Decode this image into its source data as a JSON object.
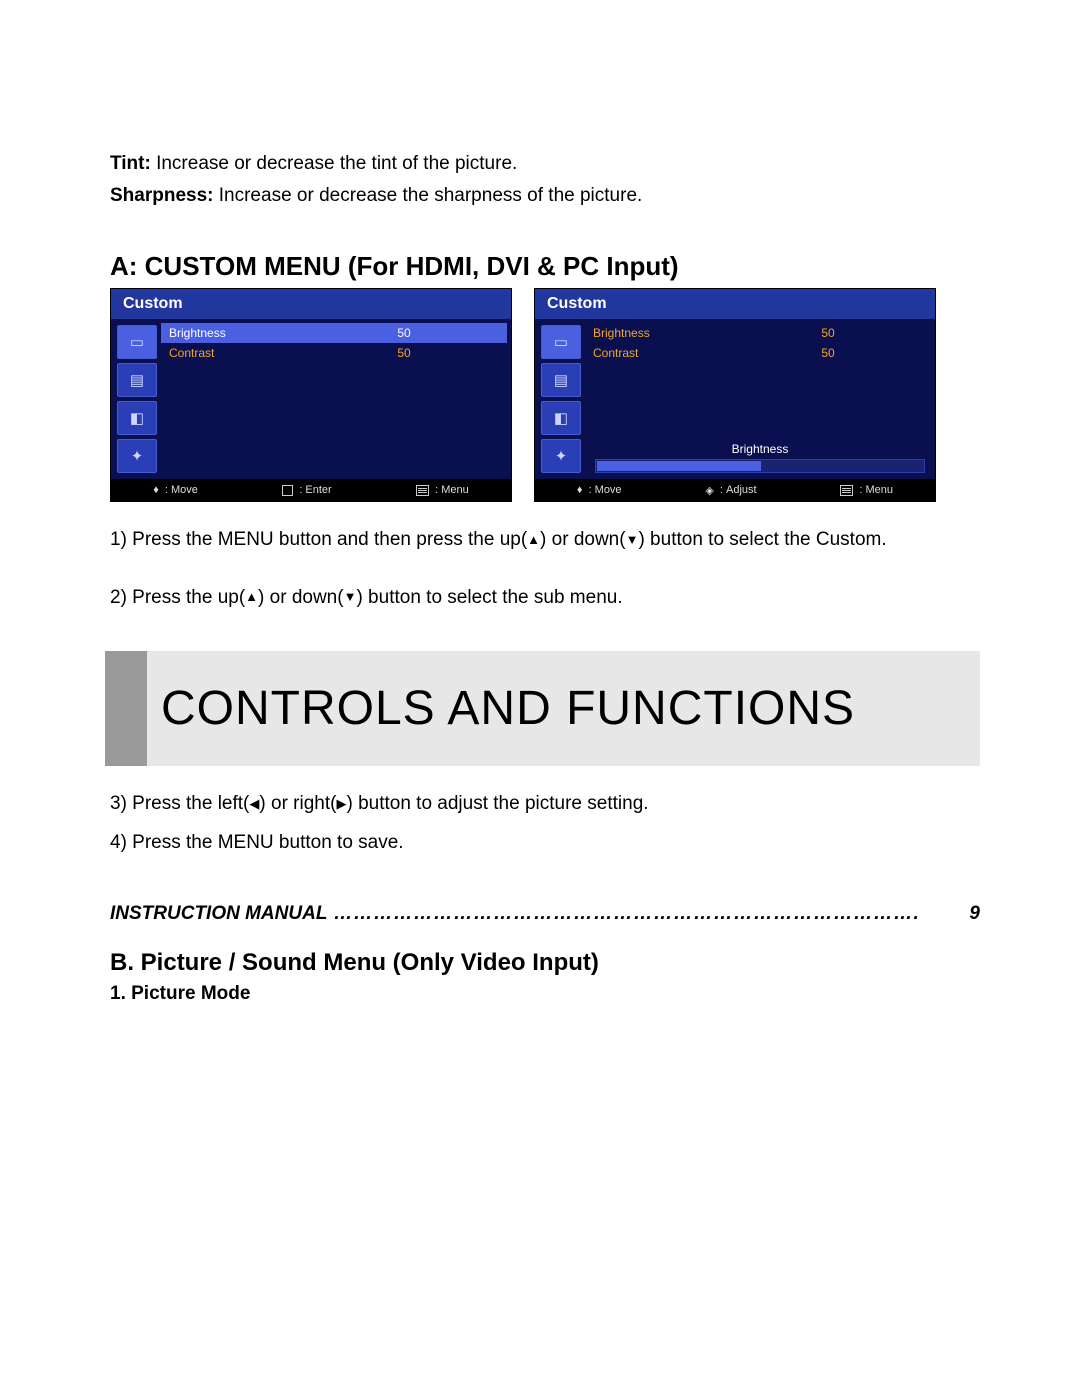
{
  "defs": {
    "tint_label": "Tint:",
    "tint_text": " Increase or decrease the tint of the picture.",
    "sharp_label": "Sharpness:",
    "sharp_text": " Increase or decrease the sharpness of the picture."
  },
  "heading_a": "A: CUSTOM MENU (For HDMI, DVI & PC Input)",
  "osd": {
    "title": "Custom",
    "rows": [
      {
        "label": "Brightness",
        "value": "50"
      },
      {
        "label": "Contrast",
        "value": "50"
      }
    ],
    "slider_label": "Brightness",
    "slider_value": "50",
    "foot_left": {
      "move": "Move",
      "enter": "Enter",
      "menu": "Menu"
    },
    "foot_right": {
      "move": "Move",
      "adjust": "Adjust",
      "menu": "Menu"
    }
  },
  "steps_a": {
    "s1a": "1) Press the MENU button and then press the up(",
    "s1b": ") or down(",
    "s1c": ") button to select the Custom.",
    "s2a": "2) Press the up(",
    "s2b": ") or down(",
    "s2c": ") button to select the sub menu."
  },
  "banner_title": "CONTROLS AND FUNCTIONS",
  "steps_b": {
    "s3a": "3) Press the left(",
    "s3b": ") or right(",
    "s3c": ") button to adjust the picture setting.",
    "s4": "4) Press the MENU button to save."
  },
  "footer": {
    "label": "INSTRUCTION MANUAL",
    "dots": "…………………………………………………………………………….",
    "page": "9"
  },
  "heading_b": "B. Picture / Sound Menu (Only Video Input)",
  "sub_b1": "1. Picture Mode",
  "glyph": {
    "up": "▲",
    "down": "▼",
    "left": "◀",
    "right": "▶",
    "updown": "◆",
    "leftright": "◇"
  }
}
